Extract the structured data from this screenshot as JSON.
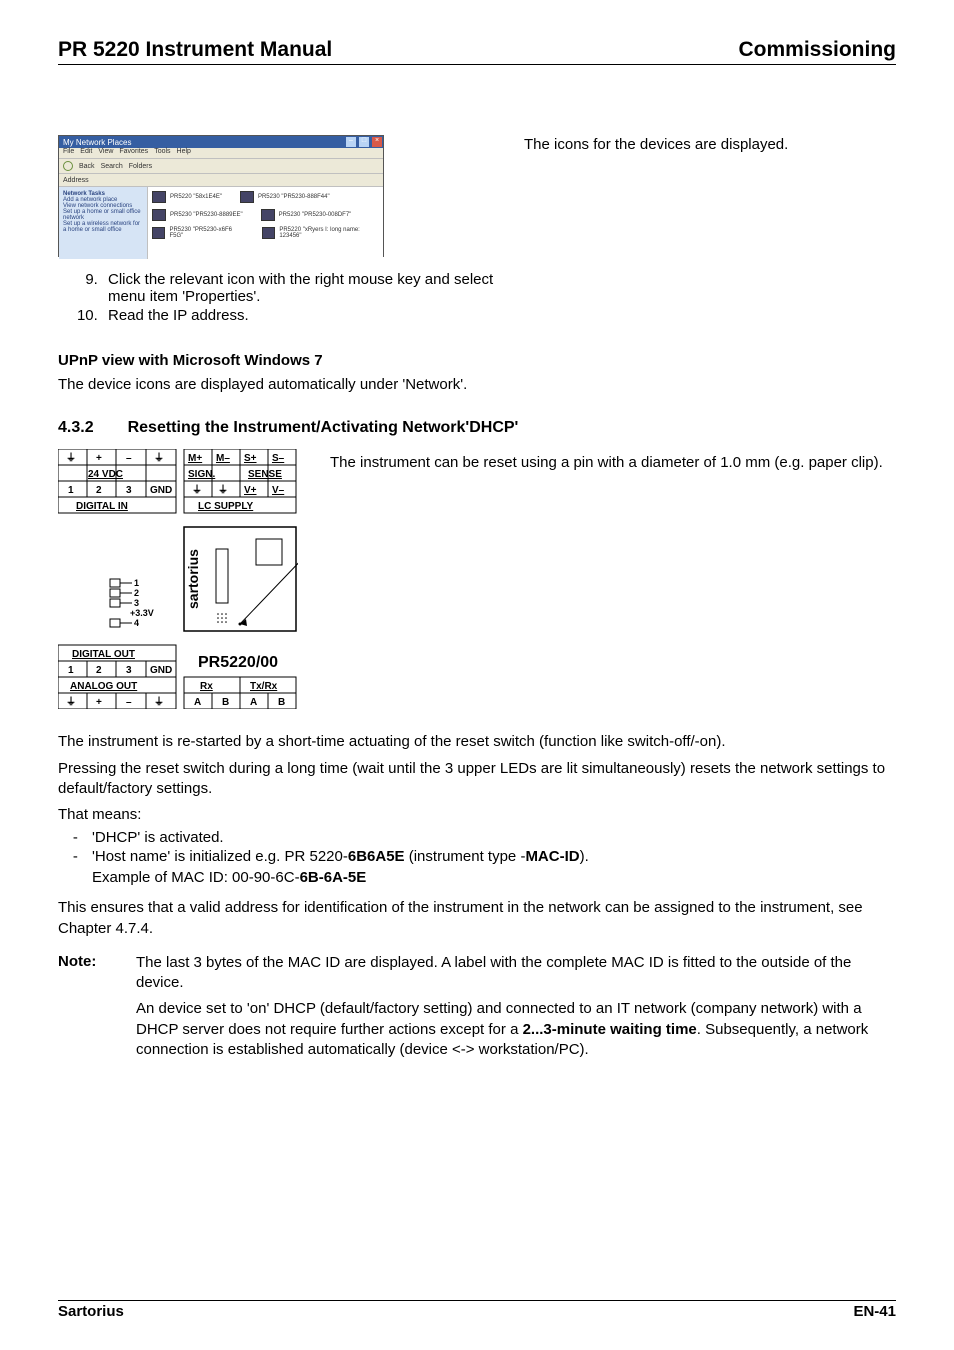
{
  "header": {
    "left": "PR 5220 Instrument Manual",
    "right": "Commissioning"
  },
  "top_caption": "The icons for the devices are displayed.",
  "screenshot": {
    "title": "My Network Places",
    "menu": [
      "File",
      "Edit",
      "View",
      "Favorites",
      "Tools",
      "Help"
    ],
    "toolbar": [
      "Back",
      "Search",
      "Folders"
    ],
    "address_label": "Address",
    "sidebar_title": "Network Tasks",
    "sidebar_items": [
      "Add a network place",
      "View network connections",
      "Set up a home or small office network",
      "Set up a wireless network for a home or small office"
    ],
    "devices": [
      {
        "label": "PR5220 \"58x1E4E\""
      },
      {
        "label": "PR5230 \"PR5230-8889EE\""
      },
      {
        "label": "PR5230 \"PR5230-x6F6 F5G\""
      },
      {
        "label": "PR5230 \"PR5230-888F44\""
      },
      {
        "label": "PR5230 \"PR5230-008DF7\""
      },
      {
        "label": "PR5220 \"xRyers I: long name: 123456\""
      }
    ]
  },
  "steps": [
    "Click the relevant icon with the right mouse key and select menu item 'Properties'.",
    "Read the IP address."
  ],
  "upnp": {
    "heading": "UPnP view with Microsoft Windows 7",
    "text": "The device icons are displayed automatically under 'Network'."
  },
  "section": {
    "number": "4.3.2",
    "title": "Resetting the Instrument/Activating Network'DHCP'"
  },
  "instrument_caption_1": "The instrument can be reset using a pin with a diameter of 1.0 mm (e.g. paper clip).",
  "diagram_labels": {
    "top_mplus": "M+",
    "top_mminus": "M–",
    "top_splus": "S+",
    "top_sminus": "S–",
    "vdc": "24 VDC",
    "sign": "SIGN.",
    "sense": "SENSE",
    "n1": "1",
    "n2": "2",
    "n3": "3",
    "gnd": "GND",
    "vp": "V+",
    "vm": "V–",
    "din": "DIGITAL IN",
    "lcs": "LC SUPPLY",
    "brand": "sartorius",
    "v33": "+3.3V",
    "p1": "1",
    "p2": "2",
    "p3": "3",
    "p4": "4",
    "dout": "DIGITAL OUT",
    "model": "PR5220/00",
    "aout": "ANALOG OUT",
    "rx": "Rx",
    "txrx": "Tx/Rx",
    "A": "A",
    "B": "B",
    "gnd_sym": "⏚",
    "plus_sym": "+",
    "minus_sym": "–"
  },
  "after_figure_p1": "The instrument is re-started by a short-time actuating of the reset switch (function like switch-off/-on).",
  "after_figure_p2": "Pressing the reset switch during a long time (wait until the 3 upper LEDs are lit simultaneously) resets the network settings to default/factory settings.",
  "that_means": "That means:",
  "bullets": [
    {
      "text": "'DHCP' is activated."
    },
    {
      "pre": "'Host name' is initialized e.g. PR 5220-",
      "bold1": "6B6A5E",
      "mid": " (instrument type -",
      "bold2": "MAC-ID",
      "post": ")."
    }
  ],
  "mac_example_label": "Example of MAC ID: 00-90-6C-",
  "mac_example_bold": "6B-6A-5E",
  "ensures_text": "This ensures that a valid address for identification of the instrument in the network can be assigned to the instrument, see Chapter 4.7.4.",
  "note": {
    "label": "Note:",
    "p1": "The last 3 bytes of the MAC ID are displayed. A label with the complete MAC ID is fitted to the outside of the device.",
    "p2_pre": "An device set to 'on' DHCP (default/factory setting) and connected to an IT network  (company network) with a DHCP server does not require further actions except for a ",
    "p2_bold": "2...3-minute waiting time",
    "p2_post": ". Subsequently, a network connection is established automatically (device <-> workstation/PC)."
  },
  "footer": {
    "left": "Sartorius",
    "right": "EN-41"
  }
}
